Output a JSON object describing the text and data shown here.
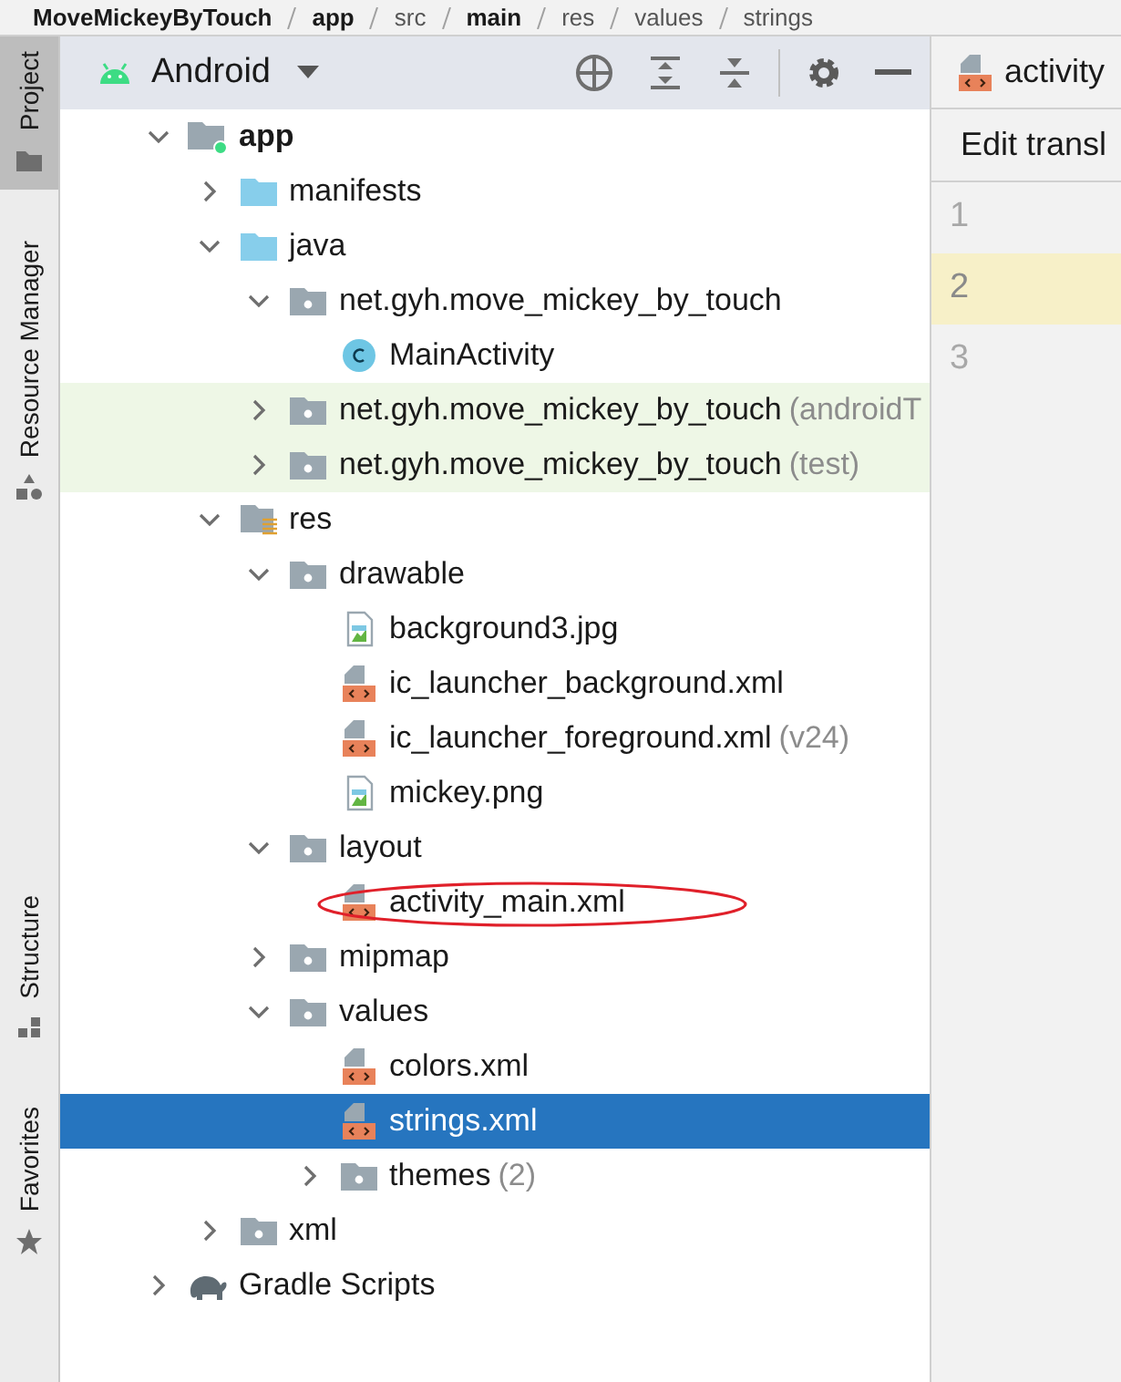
{
  "breadcrumb": [
    "MoveMickeyByTouch",
    "app",
    "src",
    "main",
    "res",
    "values",
    "strings"
  ],
  "side_tabs": [
    {
      "label": "Project",
      "selected": true
    },
    {
      "label": "Resource Manager",
      "selected": false
    },
    {
      "label": "Structure",
      "selected": false
    },
    {
      "label": "Favorites",
      "selected": false
    }
  ],
  "panel": {
    "view": "Android"
  },
  "tree": [
    {
      "label": "app",
      "kind": "module",
      "expanded": true,
      "selected": false,
      "children": [
        {
          "label": "manifests",
          "kind": "folder",
          "expanded": false,
          "selected": false
        },
        {
          "label": "java",
          "kind": "folder",
          "expanded": true,
          "selected": false,
          "children": [
            {
              "label": "net.gyh.move_mickey_by_touch",
              "kind": "package",
              "expanded": true,
              "selected": false,
              "tinted": false,
              "children": [
                {
                  "label": "MainActivity",
                  "kind": "class",
                  "selected": false
                }
              ]
            },
            {
              "label": "net.gyh.move_mickey_by_touch",
              "suffix": "(androidT",
              "kind": "package",
              "expanded": false,
              "selected": false,
              "tinted": true
            },
            {
              "label": "net.gyh.move_mickey_by_touch",
              "suffix": "(test)",
              "kind": "package",
              "expanded": false,
              "selected": false,
              "tinted": true
            }
          ]
        },
        {
          "label": "res",
          "kind": "res",
          "expanded": true,
          "selected": false,
          "children": [
            {
              "label": "drawable",
              "kind": "package",
              "expanded": true,
              "selected": false,
              "children": [
                {
                  "label": "background3.jpg",
                  "kind": "image",
                  "selected": false
                },
                {
                  "label": "ic_launcher_background.xml",
                  "kind": "xml",
                  "selected": false
                },
                {
                  "label": "ic_launcher_foreground.xml",
                  "suffix": "(v24)",
                  "kind": "xml",
                  "selected": false
                },
                {
                  "label": "mickey.png",
                  "kind": "image",
                  "selected": false
                }
              ]
            },
            {
              "label": "layout",
              "kind": "package",
              "expanded": true,
              "selected": false,
              "children": [
                {
                  "label": "activity_main.xml",
                  "kind": "xml",
                  "selected": false,
                  "circled": true
                }
              ]
            },
            {
              "label": "mipmap",
              "kind": "package",
              "expanded": false,
              "selected": false
            },
            {
              "label": "values",
              "kind": "package",
              "expanded": true,
              "selected": false,
              "children": [
                {
                  "label": "colors.xml",
                  "kind": "xml",
                  "selected": false
                },
                {
                  "label": "strings.xml",
                  "kind": "xml",
                  "selected": true
                },
                {
                  "label": "themes",
                  "suffix": "(2)",
                  "kind": "package",
                  "expanded": false,
                  "selected": false
                }
              ]
            }
          ]
        },
        {
          "label": "xml",
          "kind": "package",
          "expanded": false,
          "selected": false
        }
      ]
    },
    {
      "label": "Gradle Scripts",
      "kind": "gradle",
      "expanded": false,
      "selected": false
    }
  ],
  "editor": {
    "tab": "activity",
    "toolbar": "Edit transl",
    "lines": [
      {
        "number": "1",
        "current": false
      },
      {
        "number": "2",
        "current": true
      },
      {
        "number": "3",
        "current": false
      }
    ]
  }
}
